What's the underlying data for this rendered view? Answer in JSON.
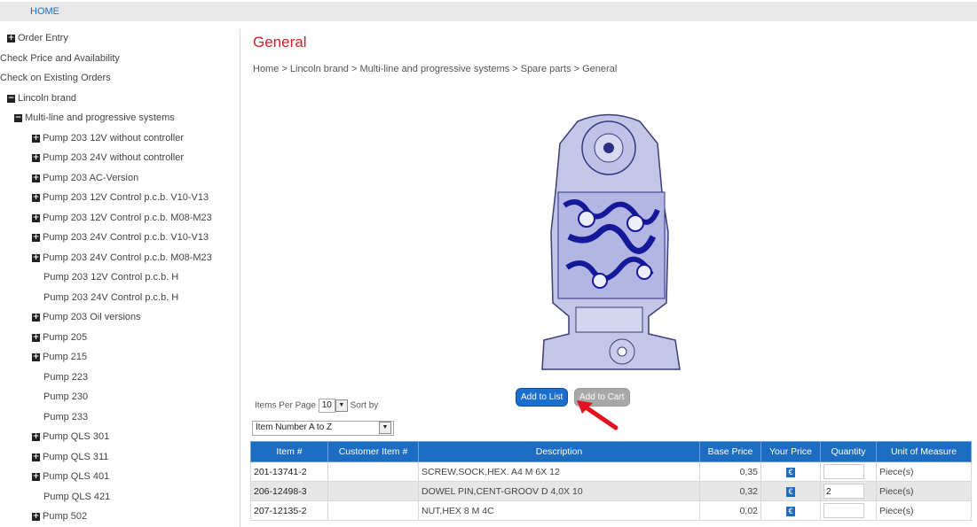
{
  "nav": {
    "home": "HOME"
  },
  "sidebar": {
    "items": [
      {
        "label": "Order Entry",
        "icon": "plus"
      },
      {
        "label": "Check Price and Availability",
        "icon": ""
      },
      {
        "label": "Check on Existing Orders",
        "icon": ""
      },
      {
        "label": "Lincoln brand",
        "icon": "minus"
      },
      {
        "label": "Multi-line and progressive systems",
        "icon": "minus"
      },
      {
        "label": "Pump 203 12V without controller",
        "icon": "plus"
      },
      {
        "label": "Pump 203 24V without controller",
        "icon": "plus"
      },
      {
        "label": "Pump 203 AC-Version",
        "icon": "plus"
      },
      {
        "label": "Pump 203 12V Control p.c.b. V10-V13",
        "icon": "plus"
      },
      {
        "label": "Pump 203 12V Control p.c.b. M08-M23",
        "icon": "plus"
      },
      {
        "label": "Pump 203 24V Control p.c.b. V10-V13",
        "icon": "plus"
      },
      {
        "label": "Pump 203 24V Control p.c.b. M08-M23",
        "icon": "plus"
      },
      {
        "label": "Pump 203 12V Control p.c.b. H",
        "icon": ""
      },
      {
        "label": "Pump 203 24V Control p.c.b. H",
        "icon": ""
      },
      {
        "label": "Pump 203 Oil versions",
        "icon": "plus"
      },
      {
        "label": "Pump 205",
        "icon": "plus"
      },
      {
        "label": "Pump 215",
        "icon": "plus"
      },
      {
        "label": "Pump 223",
        "icon": ""
      },
      {
        "label": "Pump 230",
        "icon": ""
      },
      {
        "label": "Pump 233",
        "icon": ""
      },
      {
        "label": "Pump QLS 301",
        "icon": "plus"
      },
      {
        "label": "Pump QLS 311",
        "icon": "plus"
      },
      {
        "label": "Pump QLS 401",
        "icon": "plus"
      },
      {
        "label": "Pump QLS 421",
        "icon": ""
      },
      {
        "label": "Pump 502",
        "icon": "plus"
      }
    ]
  },
  "main": {
    "title": "General",
    "breadcrumb": "Home > Lincoln brand > Multi-line and progressive systems > Spare parts > General",
    "add_to_list": "Add to List",
    "add_to_cart": "Add to Cart",
    "items_per_page_label": "Items Per Page",
    "items_per_page_value": "10",
    "sort_by_label": "Sort by",
    "sort_value": "Item Number A to Z"
  },
  "table": {
    "headers": [
      "Item #",
      "Customer Item #",
      "Description",
      "Base Price",
      "Your Price",
      "Quantity",
      "Unit of Measure"
    ],
    "rows": [
      {
        "item": "201-13741-2",
        "customer_item": "",
        "description": "SCREW,SOCK,HEX. A4 M 6X 12",
        "base_price": "0,35",
        "quantity": "",
        "unit": "Piece(s)"
      },
      {
        "item": "206-12498-3",
        "customer_item": "",
        "description": "DOWEL PIN,CENT-GROOV D 4,0X 10",
        "base_price": "0,32",
        "quantity": "2",
        "unit": "Piece(s)"
      },
      {
        "item": "207-12135-2",
        "customer_item": "",
        "description": "NUT,HEX 8 M 4C",
        "base_price": "0,02",
        "quantity": "",
        "unit": "Piece(s)"
      }
    ]
  },
  "colors": {
    "title_red": "#d0202a",
    "header_blue": "#1c6dc2",
    "button_blue": "#1a6fce",
    "arrow_red": "#e0141e"
  }
}
